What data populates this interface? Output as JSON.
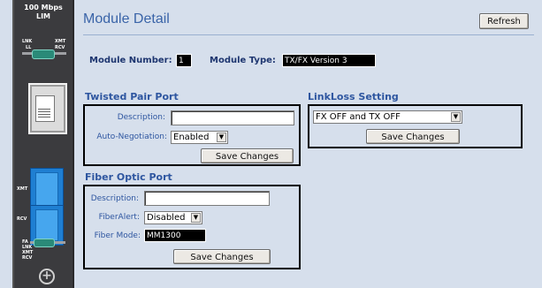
{
  "panel": {
    "title_line1": "100 Mbps",
    "title_line2": "LIM",
    "lnk_label": "LNK",
    "ll_label": "LL",
    "xmt_label": "XMT",
    "rcv_label": "RCV",
    "fiber_xmt": "XMT",
    "fiber_rcv": "RCV",
    "status_fa": "FA",
    "status_lnk": "LNK",
    "status_xmt": "XMT",
    "status_rcv": "RCV"
  },
  "header": {
    "title": "Module Detail",
    "refresh_label": "Refresh"
  },
  "module": {
    "number_label": "Module Number:",
    "number_value": "1",
    "type_label": "Module Type:",
    "type_value": "TX/FX Version 3"
  },
  "twisted_pair": {
    "title": "Twisted Pair Port",
    "description_label": "Description:",
    "description_value": "",
    "autoneg_label": "Auto-Negotiation:",
    "autoneg_value": "Enabled",
    "save_label": "Save Changes"
  },
  "linkloss": {
    "title": "LinkLoss Setting",
    "value": "FX OFF and TX OFF",
    "save_label": "Save Changes"
  },
  "fiber": {
    "title": "Fiber Optic Port",
    "description_label": "Description:",
    "description_value": "",
    "fiberalert_label": "FiberAlert:",
    "fiberalert_value": "Disabled",
    "mode_label": "Fiber Mode:",
    "mode_value": "MM1300",
    "save_label": "Save Changes"
  },
  "colors": {
    "accent": "#2e56a0",
    "background": "#d6dfec",
    "fiber_port": "#1f7fd2",
    "led": "#2a8a78"
  }
}
